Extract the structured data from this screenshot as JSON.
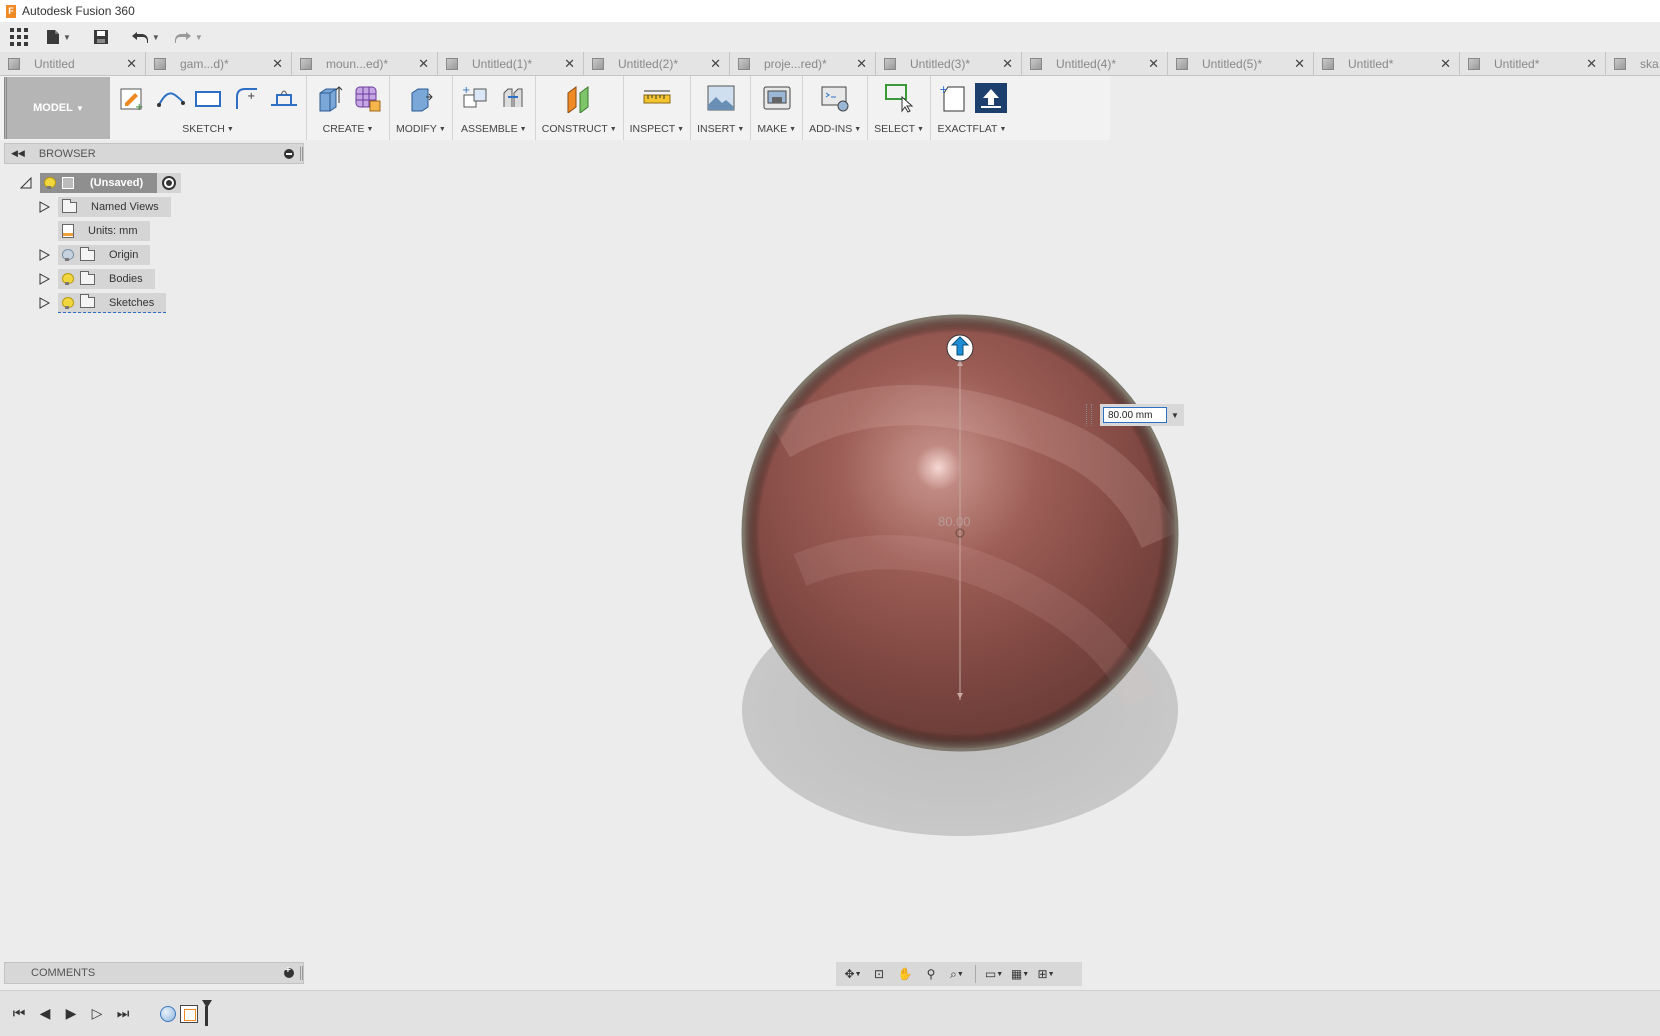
{
  "window": {
    "title": "Autodesk Fusion 360",
    "logo_letter": "F"
  },
  "quick_access": [
    "data-panel-icon",
    "file-icon",
    "save-icon",
    "undo-icon",
    "redo-icon"
  ],
  "tabs": [
    {
      "label": "Untitled"
    },
    {
      "label": "gam...d)*"
    },
    {
      "label": "moun...ed)*"
    },
    {
      "label": "Untitled(1)*"
    },
    {
      "label": "Untitled(2)*"
    },
    {
      "label": "proje...red)*"
    },
    {
      "label": "Untitled(3)*"
    },
    {
      "label": "Untitled(4)*"
    },
    {
      "label": "Untitled(5)*"
    },
    {
      "label": "Untitled*"
    },
    {
      "label": "Untitled*"
    },
    {
      "label": "ska"
    }
  ],
  "toolbar": {
    "mode": "MODEL",
    "groups": {
      "sketch": "SKETCH",
      "create": "CREATE",
      "modify": "MODIFY",
      "assemble": "ASSEMBLE",
      "construct": "CONSTRUCT",
      "inspect": "INSPECT",
      "insert": "INSERT",
      "make": "MAKE",
      "addins": "ADD-INS",
      "select": "SELECT",
      "exactflat": "EXACTFLAT"
    }
  },
  "browser": {
    "title": "BROWSER",
    "root": "(Unsaved)",
    "items": {
      "named_views": "Named Views",
      "units": "Units: mm",
      "origin": "Origin",
      "bodies": "Bodies",
      "sketches": "Sketches"
    }
  },
  "comments": {
    "title": "COMMENTS"
  },
  "viewport": {
    "dimension_value": "80.00 mm",
    "center_label": "80.00",
    "sphere_color": "#8a4a44"
  }
}
